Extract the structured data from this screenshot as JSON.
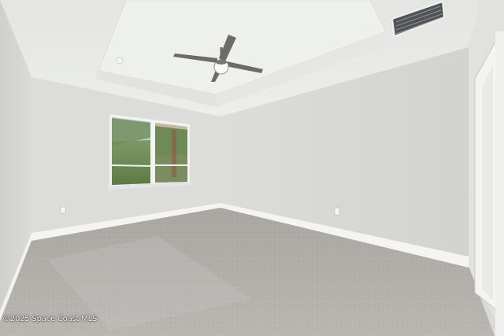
{
  "photo": {
    "subject": "empty-bedroom",
    "watermark": "©2025 Space Coast MLS"
  },
  "colors": {
    "ceiling": "#e9e9e7",
    "left_wall": "#d5d6d4",
    "back_wall": "#dfe0de",
    "right_wall": "#d9dad8",
    "carpet": "#b3afab",
    "trim": "#f5f5f3",
    "vent": "#5a5d61",
    "fan": "#6e6a68"
  },
  "icons": [
    "ceiling-fan-icon",
    "air-vent-icon",
    "window-icon",
    "door-frame-icon",
    "outlet-icon",
    "smoke-detector-icon"
  ]
}
